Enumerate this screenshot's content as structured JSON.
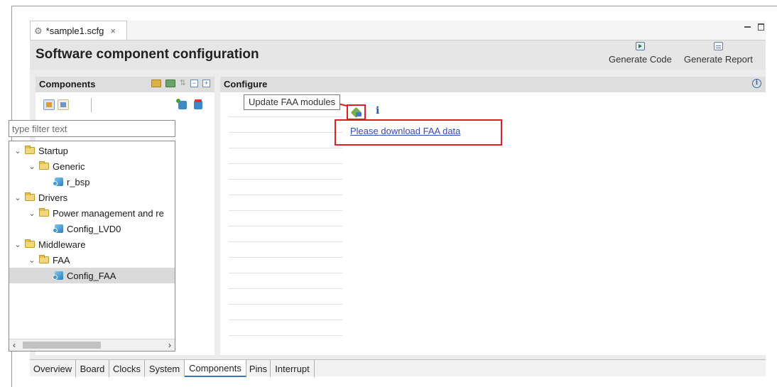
{
  "editor_tab": {
    "title": "*sample1.scfg",
    "close_glyph": "×"
  },
  "header": {
    "title": "Software component configuration",
    "generate_code_label": "Generate Code",
    "generate_report_label": "Generate Report"
  },
  "components_panel": {
    "title": "Components",
    "filter": {
      "placeholder": "type filter text",
      "value": ""
    },
    "tree": [
      {
        "label": "Startup",
        "type": "folder",
        "expanded": true,
        "level": 0
      },
      {
        "label": "Generic",
        "type": "folder",
        "expanded": true,
        "level": 1
      },
      {
        "label": "r_bsp",
        "type": "component",
        "level": 2
      },
      {
        "label": "Drivers",
        "type": "folder",
        "expanded": true,
        "level": 0
      },
      {
        "label": "Power management and re",
        "type": "folder",
        "expanded": true,
        "level": 1
      },
      {
        "label": "Config_LVD0",
        "type": "component",
        "level": 2
      },
      {
        "label": "Middleware",
        "type": "folder",
        "expanded": true,
        "level": 0
      },
      {
        "label": "FAA",
        "type": "folder",
        "expanded": true,
        "level": 1
      },
      {
        "label": "Config_FAA",
        "type": "component",
        "level": 2,
        "selected": true
      }
    ]
  },
  "configure_panel": {
    "title": "Configure",
    "tooltip": "Update FAA modules",
    "info_glyph": "i",
    "info_circle_glyph": "i",
    "download_link": "Please download FAA data"
  },
  "bottom_tabs": [
    {
      "label": "Overview",
      "active": false
    },
    {
      "label": "Board",
      "active": false
    },
    {
      "label": "Clocks",
      "active": false
    },
    {
      "label": "System",
      "active": false
    },
    {
      "label": "Components",
      "active": true
    },
    {
      "label": "Pins",
      "active": false
    },
    {
      "label": "Interrupt",
      "active": false
    }
  ],
  "colors": {
    "highlight_red": "#e02020",
    "link_blue": "#2a52b5",
    "selected_row": "#dadada",
    "header_bg": "#e6e6e6"
  },
  "icons": [
    "gear-icon",
    "close-icon",
    "generate-code-icon",
    "generate-report-icon",
    "folder-icon",
    "component-icon",
    "chevron-down-icon",
    "update-faa-icon",
    "info-icon"
  ]
}
